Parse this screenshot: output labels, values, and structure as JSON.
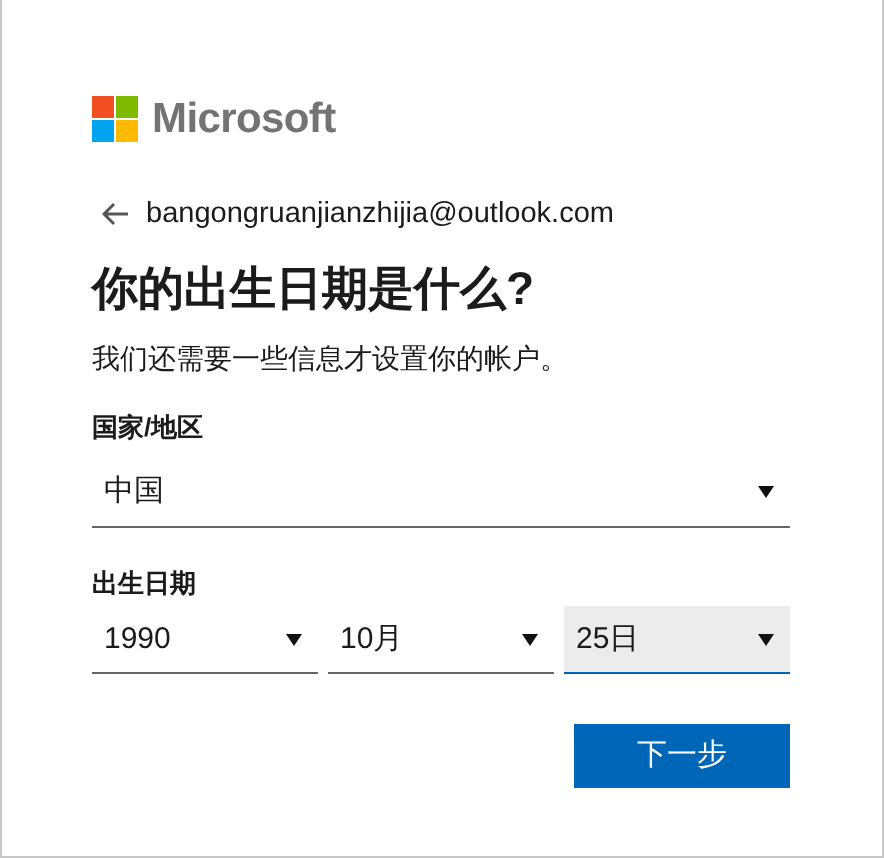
{
  "brand": {
    "name": "Microsoft"
  },
  "account": {
    "email": "bangongruanjianzhijia@outlook.com"
  },
  "heading": "你的出生日期是什么?",
  "subtitle": "我们还需要一些信息才设置你的帐户。",
  "country": {
    "label": "国家/地区",
    "value": "中国",
    "focused": false
  },
  "birthdate": {
    "label": "出生日期",
    "fields": [
      {
        "value": "1990",
        "focused": false
      },
      {
        "value": "10月",
        "focused": false
      },
      {
        "value": "25日",
        "focused": true
      }
    ]
  },
  "next_button": "下一步"
}
